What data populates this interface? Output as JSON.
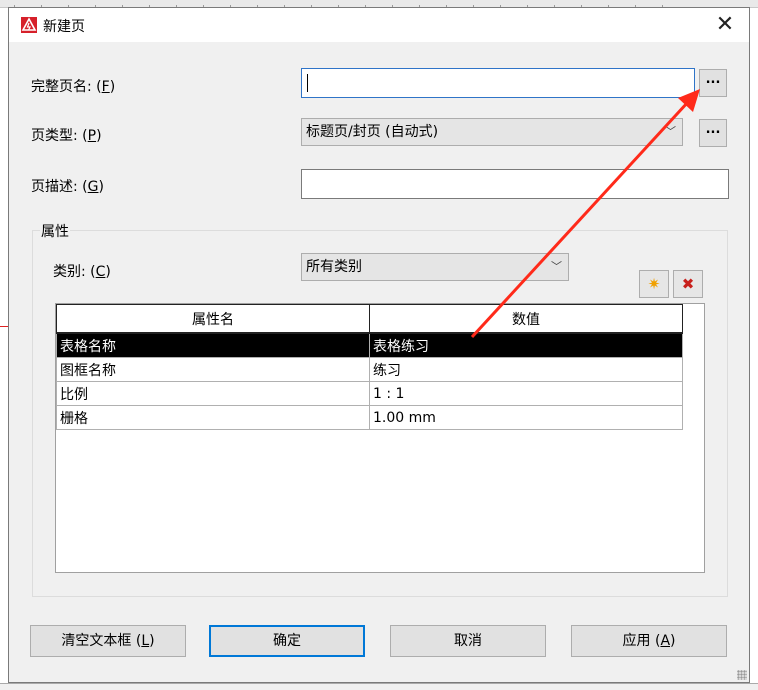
{
  "dialog": {
    "title": "新建页",
    "icon": "app-logo-icon",
    "close_glyph": "✕"
  },
  "fields": {
    "full_page_name": {
      "label": "完整页名: (",
      "key": "F",
      "suffix": ")",
      "value": "",
      "browse": "..."
    },
    "page_type": {
      "label": "页类型: (",
      "key": "P",
      "suffix": ")",
      "value": "标题页/封页 (自动式)",
      "browse": "..."
    },
    "page_description": {
      "label": "页描述: (",
      "key": "G",
      "suffix": ")",
      "value": ""
    }
  },
  "properties": {
    "group_title": "属性",
    "category": {
      "label": "类别: (",
      "key": "C",
      "suffix": ")",
      "value": "所有类别"
    },
    "add_icon": "new-property-icon",
    "delete_icon": "delete-property-icon",
    "table": {
      "headers": [
        "属性名",
        "数值"
      ],
      "rows": [
        {
          "name": "表格名称",
          "value": "表格练习"
        },
        {
          "name": "图框名称",
          "value": "练习"
        },
        {
          "name": "比例",
          "value": "1 : 1"
        },
        {
          "name": "栅格",
          "value": "1.00 mm"
        }
      ],
      "selected_row": 0
    }
  },
  "buttons": {
    "clear": {
      "label": "清空文本框 (",
      "key": "L",
      "suffix": ")"
    },
    "ok": {
      "label": "确定"
    },
    "cancel": {
      "label": "取消"
    },
    "apply": {
      "label": "应用 (",
      "key": "A",
      "suffix": ")"
    }
  },
  "colors": {
    "dialog_bg": "#f0f0f0",
    "focus_border": "#2f74c8",
    "selected_row_bg": "#000000",
    "annotation_arrow": "#ff2a1a",
    "default_button_border": "#0078d7"
  }
}
